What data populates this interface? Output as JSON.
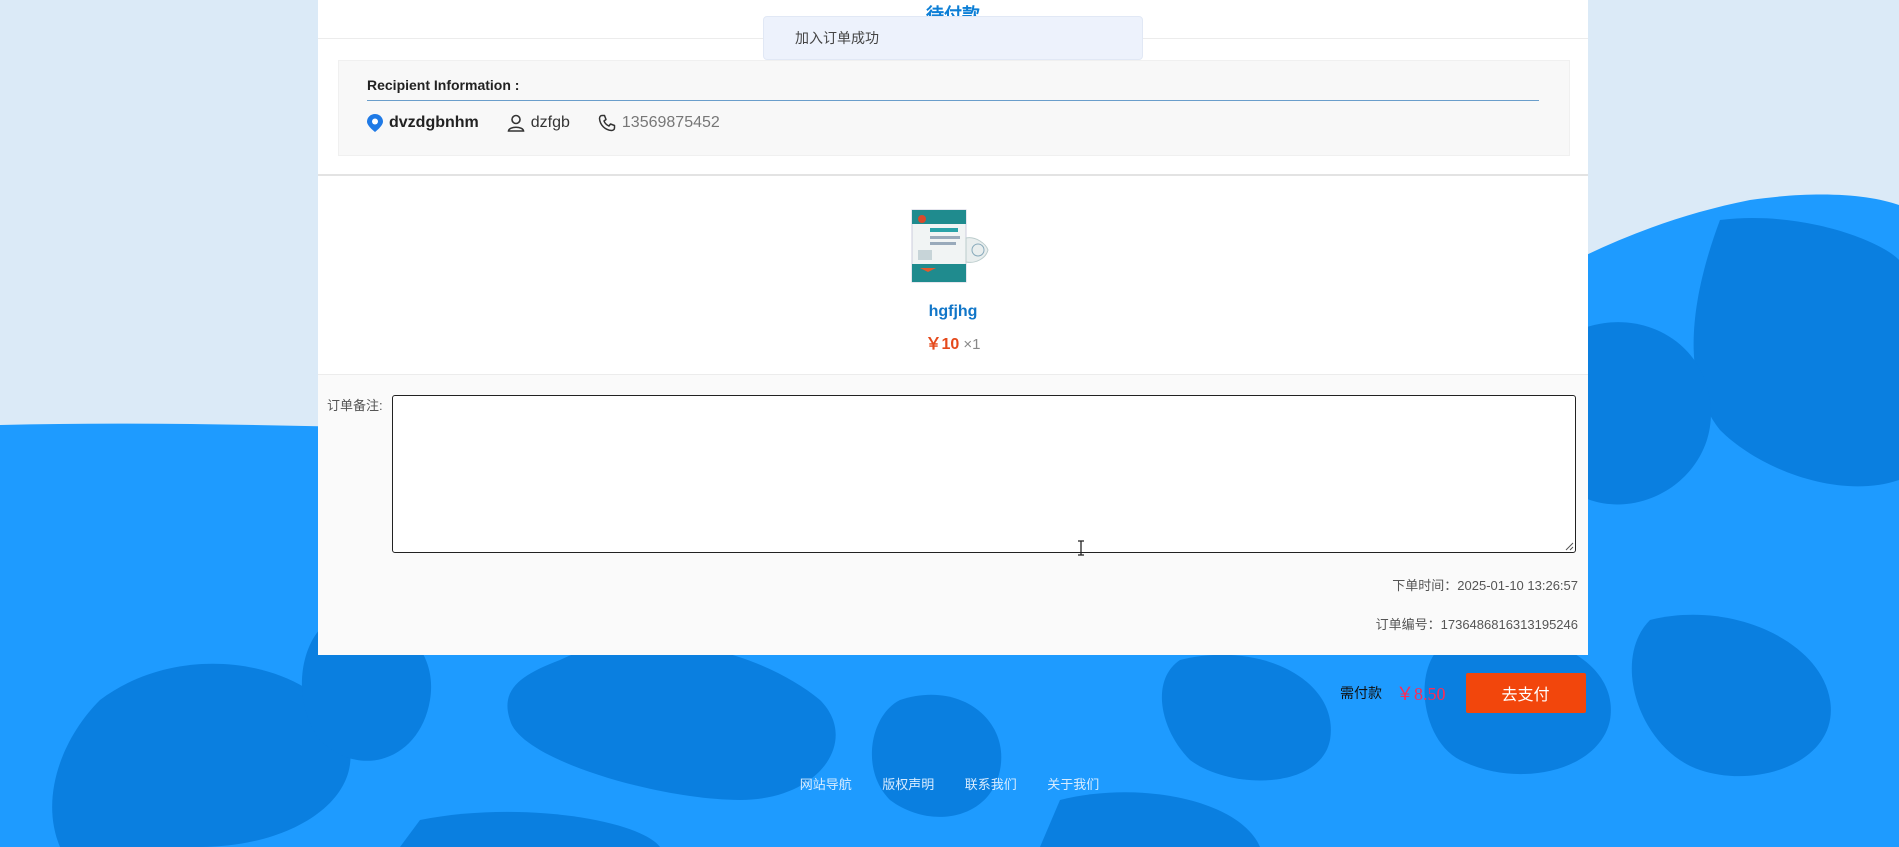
{
  "header": {
    "title": "待付款"
  },
  "toast": {
    "message": "加入订单成功"
  },
  "recipient": {
    "title": "Recipient Information :",
    "address": "dvzdgbnhm",
    "name": "dzfgb",
    "phone": "13569875452"
  },
  "product": {
    "name": "hgfjhg",
    "price": "￥10",
    "quantity": "×1"
  },
  "remark": {
    "label": "订单备注:",
    "value": ""
  },
  "order": {
    "time": "下单时间：2025-01-10 13:26:57",
    "number": "订单编号：1736486816313195246"
  },
  "payment": {
    "label": "需付款",
    "amount": "￥8.50",
    "button_label": "去支付"
  },
  "footer": {
    "links": [
      "网站导航",
      "版权声明",
      "联系我们",
      "关于我们"
    ]
  },
  "colors": {
    "accent_blue": "#0d7fd6",
    "price_orange": "#e5491b",
    "pay_button": "#f2460c",
    "pay_amount": "#ff2a55",
    "background_blue": "#1e9bff"
  },
  "icons": [
    "location-pin-icon",
    "user-icon",
    "phone-icon",
    "text-cursor-icon",
    "resize-handle-icon"
  ]
}
